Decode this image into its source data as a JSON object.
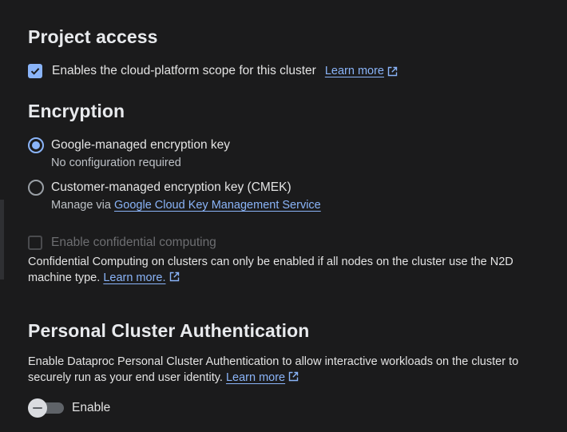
{
  "project_access": {
    "title": "Project access",
    "checkbox_label": "Enables the cloud-platform scope for this cluster",
    "checkbox_checked": true,
    "learn_more": "Learn more"
  },
  "encryption": {
    "title": "Encryption",
    "options": [
      {
        "label": "Google-managed encryption key",
        "description": "No configuration required",
        "selected": true
      },
      {
        "label": "Customer-managed encryption key (CMEK)",
        "description_prefix": "Manage via",
        "description_link": "Google Cloud Key Management Service",
        "selected": false
      }
    ],
    "confidential_label": "Enable confidential computing",
    "confidential_help": "Confidential Computing on clusters can only be enabled if all nodes on the cluster use the N2D machine type.",
    "confidential_learn_more": "Learn more."
  },
  "personal_auth": {
    "title": "Personal Cluster Authentication",
    "description": "Enable Dataproc Personal Cluster Authentication to allow interactive workloads on the cluster to securely run as your end user identity.",
    "learn_more": "Learn more",
    "toggle_label": "Enable",
    "toggle_on": false
  },
  "colors": {
    "background": "#1b1b1c",
    "accent": "#8ab4f8",
    "text": "#e3e3e3",
    "disabled": "#6d6e71"
  }
}
